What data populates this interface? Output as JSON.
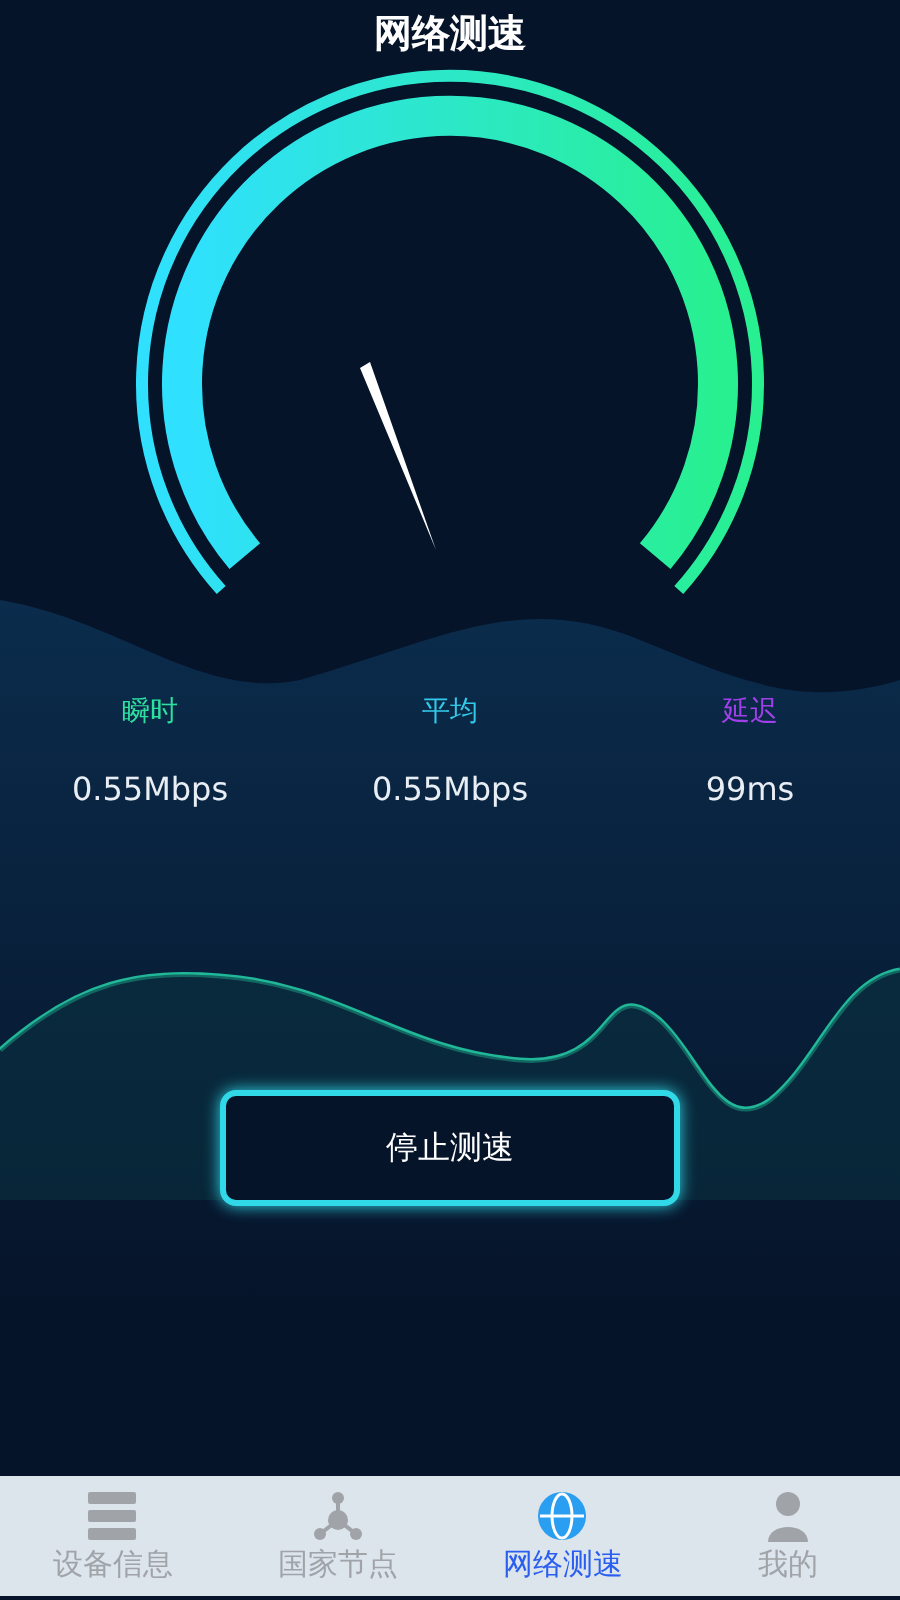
{
  "title": "网络测速",
  "stats": [
    {
      "label": "瞬时",
      "value": "0.55Mbps",
      "color": "#2ee0a0"
    },
    {
      "label": "平均",
      "value": "0.55Mbps",
      "color": "#33c8e8"
    },
    {
      "label": "延迟",
      "value": "99ms",
      "color": "#a040e8"
    }
  ],
  "button": "停止测速",
  "tabs": [
    {
      "label": "设备信息",
      "selected": false
    },
    {
      "label": "国家节点",
      "selected": false
    },
    {
      "label": "网络测速",
      "selected": true
    },
    {
      "label": "我的",
      "selected": false
    }
  ]
}
